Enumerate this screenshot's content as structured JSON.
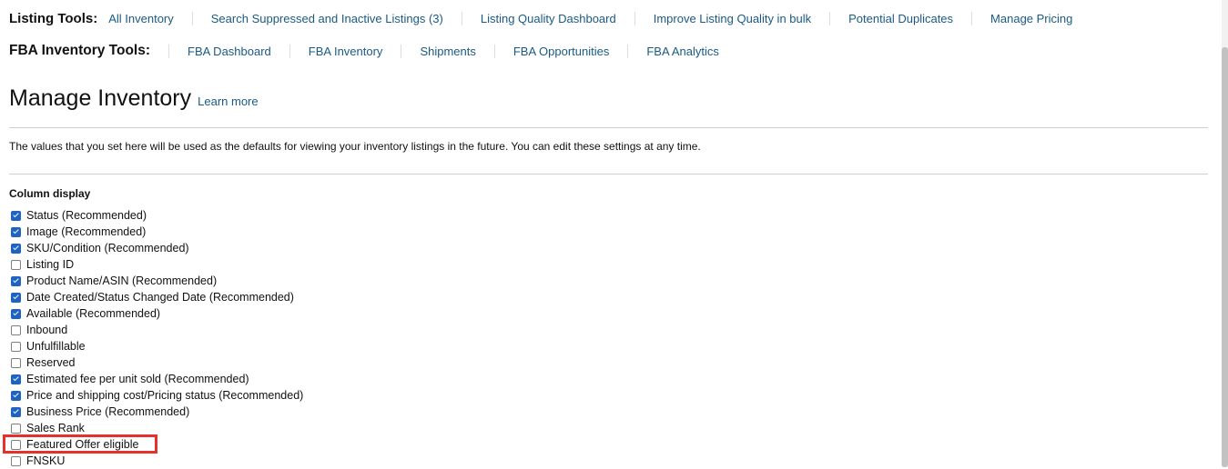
{
  "listing_tools": {
    "label": "Listing Tools:",
    "links": [
      "All Inventory",
      "Search Suppressed and Inactive Listings (3)",
      "Listing Quality Dashboard",
      "Improve Listing Quality in bulk",
      "Potential Duplicates",
      "Manage Pricing"
    ]
  },
  "fba_tools": {
    "label": "FBA Inventory Tools:",
    "links": [
      "FBA Dashboard",
      "FBA Inventory",
      "Shipments",
      "FBA Opportunities",
      "FBA Analytics"
    ]
  },
  "page": {
    "title": "Manage Inventory",
    "learn_more": "Learn more",
    "description": "The values that you set here will be used as the defaults for viewing your inventory listings in the future. You can edit these settings at any time."
  },
  "column_display": {
    "title": "Column display",
    "items": [
      {
        "label": "Status (Recommended)",
        "checked": true
      },
      {
        "label": "Image (Recommended)",
        "checked": true
      },
      {
        "label": "SKU/Condition (Recommended)",
        "checked": true
      },
      {
        "label": "Listing ID",
        "checked": false
      },
      {
        "label": "Product Name/ASIN (Recommended)",
        "checked": true
      },
      {
        "label": "Date Created/Status Changed Date (Recommended)",
        "checked": true
      },
      {
        "label": "Available (Recommended)",
        "checked": true
      },
      {
        "label": "Inbound",
        "checked": false
      },
      {
        "label": "Unfulfillable",
        "checked": false
      },
      {
        "label": "Reserved",
        "checked": false
      },
      {
        "label": "Estimated fee per unit sold (Recommended)",
        "checked": true
      },
      {
        "label": "Price and shipping cost/Pricing status (Recommended)",
        "checked": true
      },
      {
        "label": "Business Price (Recommended)",
        "checked": true
      },
      {
        "label": "Sales Rank",
        "checked": false
      },
      {
        "label": "Featured Offer eligible",
        "checked": false
      },
      {
        "label": "FNSKU",
        "checked": false
      }
    ]
  },
  "colors": {
    "link": "#1a5a84",
    "checkbox_checked": "#1f63c2",
    "highlight": "#e8302a"
  }
}
